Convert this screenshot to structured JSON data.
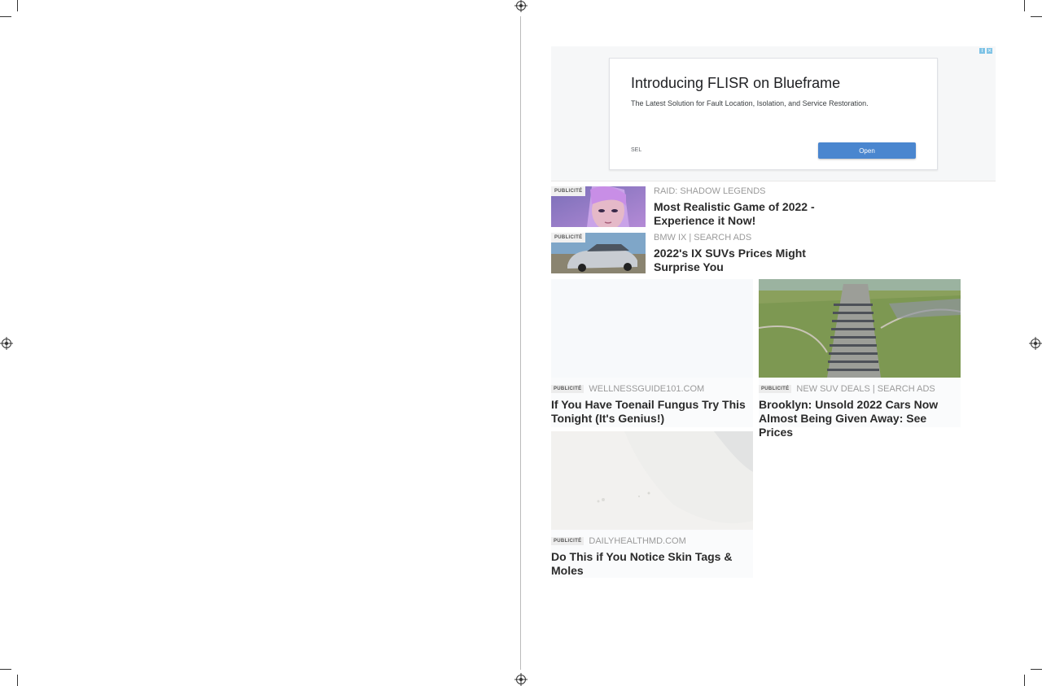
{
  "display_ad": {
    "title": "Introducing FLISR on Blueframe",
    "description": "The Latest Solution for Fault Location, Isolation, and Service Restoration.",
    "sponsor": "SEL",
    "button_label": "Open"
  },
  "list_items": [
    {
      "badge": "PUBLICITÉ",
      "source": "RAID: SHADOW LEGENDS",
      "headline": "Most Realistic Game of 2022 - Experience it Now!"
    },
    {
      "badge": "PUBLICITÉ",
      "source": "BMW IX | SEARCH ADS",
      "headline": "2022's IX SUVs Prices Might Surprise You"
    }
  ],
  "cards": [
    {
      "badge": "PUBLICITÉ",
      "source": "WELLNESSGUIDE101.COM",
      "title": "If You Have Toenail Fungus Try This Tonight (It's Genius!)"
    },
    {
      "badge": "PUBLICITÉ",
      "source": "NEW SUV DEALS | SEARCH ADS",
      "title": "Brooklyn: Unsold 2022 Cars Now Almost Being Given Away: See Prices"
    },
    {
      "badge": "PUBLICITÉ",
      "source": "DAILYHEALTHMD.COM",
      "title": "Do This if You Notice Skin Tags & Moles"
    }
  ],
  "icons": {
    "adchoices": [
      "info-icon",
      "close-icon"
    ],
    "registration_mark": "registration-mark-icon"
  }
}
